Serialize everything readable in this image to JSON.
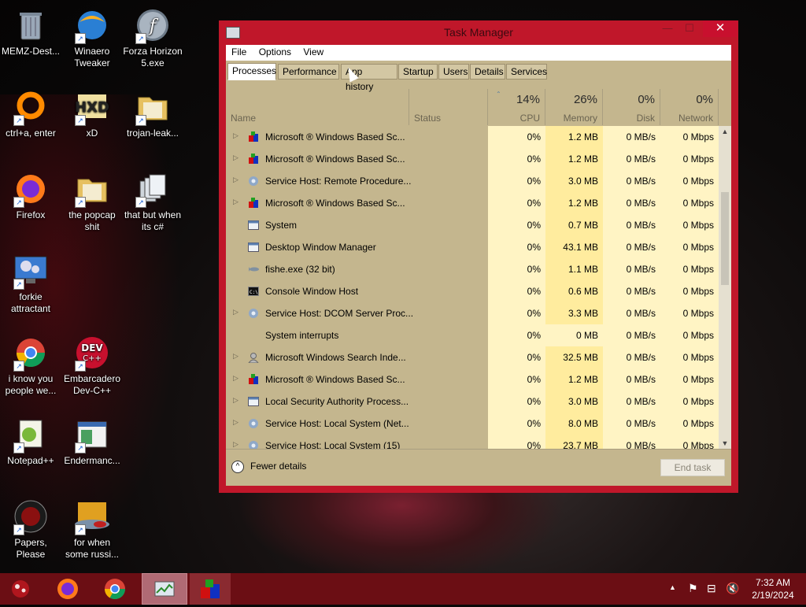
{
  "desktop": {
    "icons": [
      {
        "label": "MEMZ-Dest...",
        "icon": "recycle-bin-icon"
      },
      {
        "label": "Winaero Tweaker",
        "icon": "winaero-icon"
      },
      {
        "label": "Forza Horizon 5.exe",
        "icon": "flash-icon"
      },
      {
        "label": "ctrl+a, enter",
        "icon": "ring-icon"
      },
      {
        "label": "xD",
        "icon": "hxd-icon"
      },
      {
        "label": "trojan-leak...",
        "icon": "folder-icon"
      },
      {
        "label": "Firefox",
        "icon": "firefox-icon"
      },
      {
        "label": "the popcap shit",
        "icon": "folder-icon"
      },
      {
        "label": "that but when its c#",
        "icon": "copy-icon"
      },
      {
        "label": "forkie attractant",
        "icon": "monitor-gear-icon"
      },
      {
        "label": "i know you people we...",
        "icon": "chrome-icon"
      },
      {
        "label": "Embarcadero Dev-C++",
        "icon": "devcpp-icon"
      },
      {
        "label": "Notepad++",
        "icon": "notepadpp-icon"
      },
      {
        "label": "Endermanc...",
        "icon": "window-icon"
      },
      {
        "label": "Papers, Please",
        "icon": "papers-please-icon"
      },
      {
        "label": "for when some russi...",
        "icon": "fish-icon"
      }
    ]
  },
  "window": {
    "title": "Task Manager",
    "close_glyph": "✕",
    "minimize_glyph": "—",
    "maximize_glyph": "☐",
    "menu": [
      "File",
      "Options",
      "View"
    ],
    "tabs": [
      "Processes",
      "Performance",
      "App history",
      "Startup",
      "Users",
      "Details",
      "Services"
    ],
    "active_tab": "Processes",
    "columns": {
      "name": "Name",
      "status": "Status",
      "cpu_pct": "14%",
      "cpu": "CPU",
      "mem_pct": "26%",
      "mem": "Memory",
      "disk_pct": "0%",
      "disk": "Disk",
      "net_pct": "0%",
      "net": "Network"
    },
    "rows": [
      {
        "name": "Microsoft ® Windows Based Sc...",
        "expand": true,
        "icon": "app-red-icon",
        "cpu": "0%",
        "mem": "1.2 MB",
        "disk": "0 MB/s",
        "net": "0 Mbps"
      },
      {
        "name": "Microsoft ® Windows Based Sc...",
        "expand": true,
        "icon": "app-red-icon",
        "cpu": "0%",
        "mem": "1.2 MB",
        "disk": "0 MB/s",
        "net": "0 Mbps"
      },
      {
        "name": "Service Host: Remote Procedure...",
        "expand": true,
        "icon": "gear-icon",
        "cpu": "0%",
        "mem": "3.0 MB",
        "disk": "0 MB/s",
        "net": "0 Mbps"
      },
      {
        "name": "Microsoft ® Windows Based Sc...",
        "expand": true,
        "icon": "app-red-icon",
        "cpu": "0%",
        "mem": "1.2 MB",
        "disk": "0 MB/s",
        "net": "0 Mbps"
      },
      {
        "name": "System",
        "expand": false,
        "icon": "window-small-icon",
        "cpu": "0%",
        "mem": "0.7 MB",
        "disk": "0 MB/s",
        "net": "0 Mbps"
      },
      {
        "name": "Desktop Window Manager",
        "expand": false,
        "icon": "window-small-icon",
        "cpu": "0%",
        "mem": "43.1 MB",
        "disk": "0 MB/s",
        "net": "0 Mbps"
      },
      {
        "name": "fishe.exe (32 bit)",
        "expand": false,
        "icon": "fish-small-icon",
        "cpu": "0%",
        "mem": "1.1 MB",
        "disk": "0 MB/s",
        "net": "0 Mbps"
      },
      {
        "name": "Console Window Host",
        "expand": false,
        "icon": "console-icon",
        "cpu": "0%",
        "mem": "0.6 MB",
        "disk": "0 MB/s",
        "net": "0 Mbps"
      },
      {
        "name": "Service Host: DCOM Server Proc...",
        "expand": true,
        "icon": "gear-icon",
        "cpu": "0%",
        "mem": "3.3 MB",
        "disk": "0 MB/s",
        "net": "0 Mbps"
      },
      {
        "name": "System interrupts",
        "expand": false,
        "icon": "none",
        "cpu": "0%",
        "mem": "0 MB",
        "disk": "0 MB/s",
        "net": "0 Mbps"
      },
      {
        "name": "Microsoft Windows Search Inde...",
        "expand": true,
        "icon": "search-user-icon",
        "cpu": "0%",
        "mem": "32.5 MB",
        "disk": "0 MB/s",
        "net": "0 Mbps"
      },
      {
        "name": "Microsoft ® Windows Based Sc...",
        "expand": true,
        "icon": "app-red-icon",
        "cpu": "0%",
        "mem": "1.2 MB",
        "disk": "0 MB/s",
        "net": "0 Mbps"
      },
      {
        "name": "Local Security Authority Process...",
        "expand": true,
        "icon": "window-small-icon",
        "cpu": "0%",
        "mem": "3.0 MB",
        "disk": "0 MB/s",
        "net": "0 Mbps"
      },
      {
        "name": "Service Host: Local System (Net...",
        "expand": true,
        "icon": "gear-icon",
        "cpu": "0%",
        "mem": "8.0 MB",
        "disk": "0 MB/s",
        "net": "0 Mbps"
      },
      {
        "name": "Service Host: Local System (15)",
        "expand": true,
        "icon": "gear-icon",
        "cpu": "0%",
        "mem": "23.7 MB",
        "disk": "0 MB/s",
        "net": "0 Mbps"
      }
    ],
    "fewer_details": "Fewer details",
    "end_task": "End task"
  },
  "taskbar": {
    "time": "7:32 AM",
    "date": "2/19/2024",
    "items": [
      "start-icon",
      "firefox-icon",
      "chrome-icon",
      "task-manager-icon",
      "app-red-icon"
    ]
  },
  "colors": {
    "accent": "#c0172a",
    "taskbar": "#6b0e14",
    "window_bg": "#c4b68e",
    "cpu_col": "#fff4c4",
    "mem_col": "#ffec9e"
  }
}
